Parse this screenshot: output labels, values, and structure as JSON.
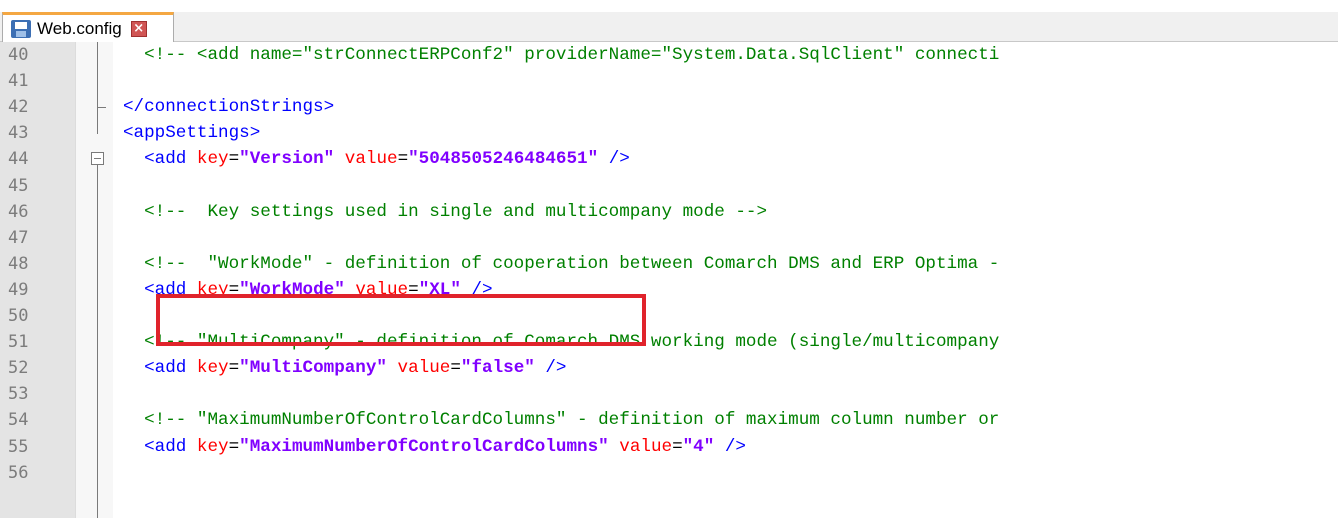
{
  "tab": {
    "title": "Web.config",
    "close_symbol": "×"
  },
  "lines": [
    {
      "n": "40",
      "indent": "  ",
      "comment": "<!-- <add name=\"strConnectERPConf2\" providerName=\"System.Data.SqlClient\" connecti"
    },
    {
      "n": "41"
    },
    {
      "n": "42",
      "indent": "",
      "tag": "</connectionStrings>"
    },
    {
      "n": "43",
      "indent": "",
      "tag": "<appSettings>"
    },
    {
      "n": "44",
      "indent": "  ",
      "open": "<add",
      "key_attr": "key",
      "key_val": "\"Version\"",
      "val_attr": "value",
      "val_val": "\"5048505246484651\"",
      "close": "/>"
    },
    {
      "n": "45"
    },
    {
      "n": "46",
      "indent": "  ",
      "comment": "<!--  Key settings used in single and multicompany mode -->"
    },
    {
      "n": "47"
    },
    {
      "n": "48",
      "indent": "  ",
      "comment": "<!--  \"WorkMode\" - definition of cooperation between Comarch DMS and ERP Optima -"
    },
    {
      "n": "49",
      "indent": "  ",
      "open": "<add",
      "key_attr": "key",
      "key_val": "\"WorkMode\"",
      "val_attr": "value",
      "val_val": "\"XL\"",
      "close": "/>"
    },
    {
      "n": "50"
    },
    {
      "n": "51",
      "indent": "  ",
      "comment": "<!-- \"MultiCompany\" - definition of Comarch DMS working mode (single/multicompany"
    },
    {
      "n": "52",
      "indent": "  ",
      "open": "<add",
      "key_attr": "key",
      "key_val": "\"MultiCompany\"",
      "val_attr": "value",
      "val_val": "\"false\"",
      "close": "/>"
    },
    {
      "n": "53"
    },
    {
      "n": "54",
      "indent": "  ",
      "comment": "<!-- \"MaximumNumberOfControlCardColumns\" - definition of maximum column number or"
    },
    {
      "n": "55",
      "indent": "  ",
      "open": "<add",
      "key_attr": "key",
      "key_val": "\"MaximumNumberOfControlCardColumns\"",
      "val_attr": "value",
      "val_val": "\"4\"",
      "close": "/>"
    },
    {
      "n": "56"
    }
  ],
  "colors": {
    "comment": "#008000",
    "tag": "#0000ff",
    "attribute": "#ff0000",
    "string": "#8000ff",
    "highlight_box": "#e0232b",
    "tab_accent": "#f4a742"
  }
}
